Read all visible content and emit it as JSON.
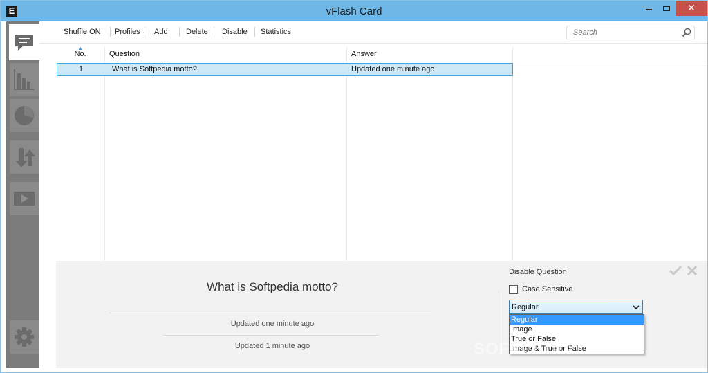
{
  "window": {
    "title": "vFlash Card",
    "app_icon_letter": "E",
    "close_glyph": "✕"
  },
  "toolbar": {
    "items": [
      "Shuffle ON",
      "Profiles",
      "Add",
      "Delete",
      "Disable",
      "Statistics"
    ]
  },
  "search": {
    "placeholder": "Search"
  },
  "sidebar": {
    "items": [
      "cards-icon",
      "bar-chart-icon",
      "pie-chart-icon",
      "import-export-icon",
      "play-icon",
      "settings-icon"
    ]
  },
  "table": {
    "columns": [
      "No.",
      "Question",
      "Answer"
    ],
    "rows": [
      {
        "no": "1",
        "question": "What is Softpedia motto?",
        "answer": "Updated one minute ago"
      }
    ]
  },
  "preview": {
    "question": "What is Softpedia motto?",
    "answer_primary": "Updated one minute ago",
    "answer_secondary": "Updated 1 minute ago"
  },
  "options": {
    "disable_label": "Disable Question",
    "case_sensitive_label": "Case Sensitive",
    "case_sensitive_checked": false,
    "type_selected": "Regular",
    "type_options": [
      "Regular",
      "Image",
      "True or False",
      "Image & True or False"
    ]
  },
  "watermark": "SOFTPEDIA",
  "colors": {
    "titlebar": "#6fb7e6",
    "sidebar": "#7b7b7b",
    "selection_row": "#cde8f7",
    "dropdown_highlight": "#3399ff",
    "close_button": "#c7504b"
  }
}
